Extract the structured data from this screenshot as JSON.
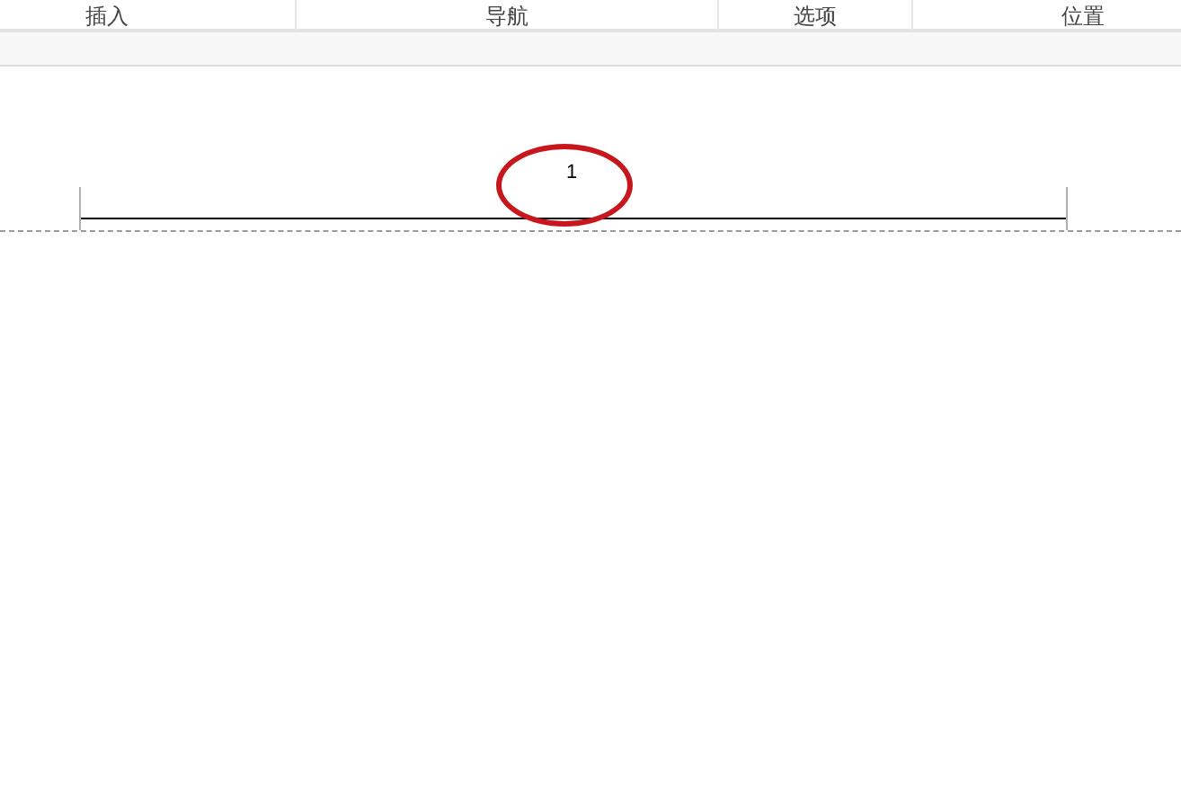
{
  "ribbon_groups": [
    {
      "label": "插入"
    },
    {
      "label": "导航"
    },
    {
      "label": "选项"
    },
    {
      "label": "位置"
    }
  ],
  "header": {
    "page_number": "1",
    "circled": true
  }
}
